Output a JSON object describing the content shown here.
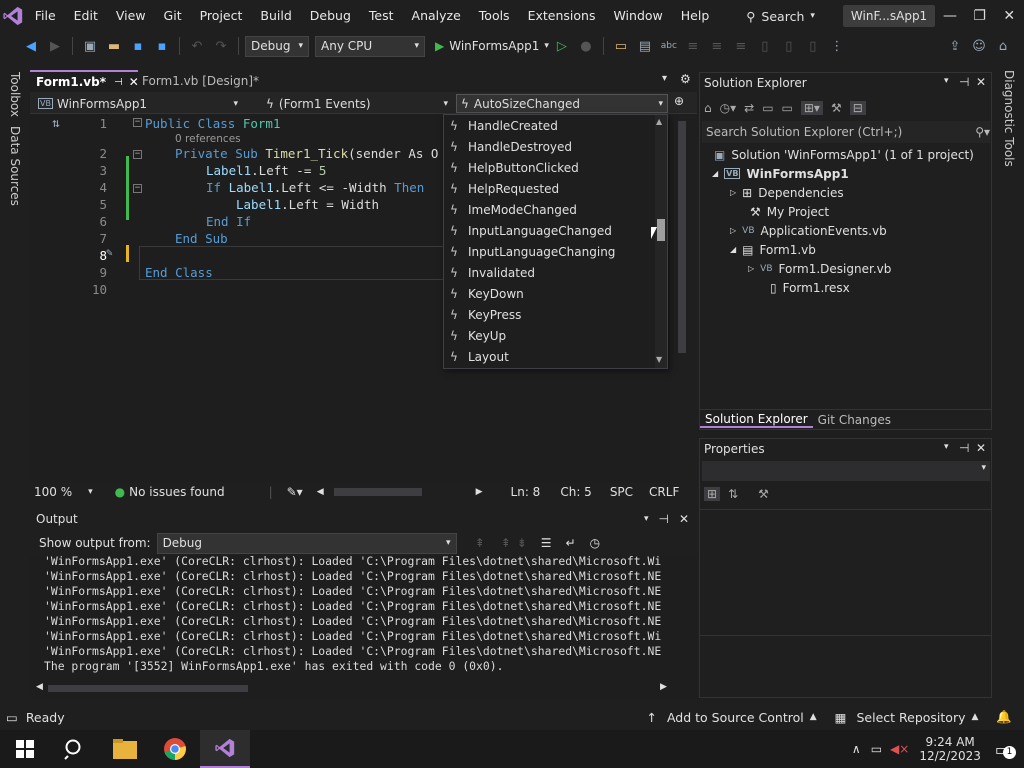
{
  "menubar": {
    "items": [
      "File",
      "Edit",
      "View",
      "Git",
      "Project",
      "Build",
      "Debug",
      "Test",
      "Analyze",
      "Tools",
      "Extensions",
      "Window",
      "Help"
    ],
    "search_label": "Search",
    "solution_name": "WinF...sApp1"
  },
  "toolbar": {
    "config": "Debug",
    "platform": "Any CPU",
    "start_label": "WinFormsApp1"
  },
  "left_tools": {
    "toolbox": "Toolbox",
    "data_sources": "Data Sources"
  },
  "right_tools": {
    "diagnostic": "Diagnostic Tools"
  },
  "editor": {
    "tabs": [
      {
        "label": "Form1.vb*"
      },
      {
        "label": "Form1.vb [Design]*"
      }
    ],
    "nav": {
      "project": "WinFormsApp1",
      "object": "(Form1 Events)",
      "member": "AutoSizeChanged"
    },
    "line_numbers": [
      "1",
      "2",
      "3",
      "4",
      "5",
      "6",
      "7",
      "8",
      "9",
      "10"
    ],
    "references": "0 references",
    "code": {
      "l1_kw": "Public Class",
      "l1_name": "Form1",
      "l2_kw1": "Private Sub",
      "l2_fn": "Timer1_Tick",
      "l2_rest": "(sender As O",
      "l3_a": "Label1",
      "l3_b": ".Left -= ",
      "l3_num": "5",
      "l4_kw": "If",
      "l4_a": "Label1",
      "l4_b": ".Left <= -Width",
      "l4_then": "Then",
      "l5_a": "Label1",
      "l5_b": ".Left = Width",
      "l6": "End If",
      "l7": "End Sub",
      "l9": "End Class"
    },
    "zoom": "100 %",
    "issues": "No issues found",
    "line": "Ln: 8",
    "col": "Ch: 5",
    "spc": "SPC",
    "eol": "CRLF"
  },
  "event_list": [
    "HandleCreated",
    "HandleDestroyed",
    "HelpButtonClicked",
    "HelpRequested",
    "ImeModeChanged",
    "InputLanguageChanged",
    "InputLanguageChanging",
    "Invalidated",
    "KeyDown",
    "KeyPress",
    "KeyUp",
    "Layout"
  ],
  "output": {
    "title": "Output",
    "show_from_label": "Show output from:",
    "source": "Debug",
    "lines": [
      "'WinFormsApp1.exe' (CoreCLR: clrhost): Loaded 'C:\\Program Files\\dotnet\\shared\\Microsoft.Wi",
      "'WinFormsApp1.exe' (CoreCLR: clrhost): Loaded 'C:\\Program Files\\dotnet\\shared\\Microsoft.NE",
      "'WinFormsApp1.exe' (CoreCLR: clrhost): Loaded 'C:\\Program Files\\dotnet\\shared\\Microsoft.NE",
      "'WinFormsApp1.exe' (CoreCLR: clrhost): Loaded 'C:\\Program Files\\dotnet\\shared\\Microsoft.NE",
      "'WinFormsApp1.exe' (CoreCLR: clrhost): Loaded 'C:\\Program Files\\dotnet\\shared\\Microsoft.NE",
      "'WinFormsApp1.exe' (CoreCLR: clrhost): Loaded 'C:\\Program Files\\dotnet\\shared\\Microsoft.Wi",
      "'WinFormsApp1.exe' (CoreCLR: clrhost): Loaded 'C:\\Program Files\\dotnet\\shared\\Microsoft.NE",
      "The program '[3552] WinFormsApp1.exe' has exited with code 0 (0x0)."
    ]
  },
  "solution_explorer": {
    "title": "Solution Explorer",
    "search_placeholder": "Search Solution Explorer (Ctrl+;)",
    "solution": "Solution 'WinFormsApp1' (1 of 1 project)",
    "project": "WinFormsApp1",
    "items": [
      "Dependencies",
      "My Project",
      "ApplicationEvents.vb",
      "Form1.vb",
      "Form1.Designer.vb",
      "Form1.resx"
    ],
    "tab_active": "Solution Explorer",
    "tab_other": "Git Changes"
  },
  "properties": {
    "title": "Properties"
  },
  "statusbar": {
    "ready": "Ready",
    "source_control": "Add to Source Control",
    "repo": "Select Repository"
  },
  "taskbar": {
    "time": "9:24 AM",
    "date": "12/2/2023",
    "notif_count": "1"
  },
  "colors": {
    "accent": "#b180d7",
    "keyword": "#569cd6",
    "type": "#4ec9b0",
    "method": "#dcdcaa"
  }
}
